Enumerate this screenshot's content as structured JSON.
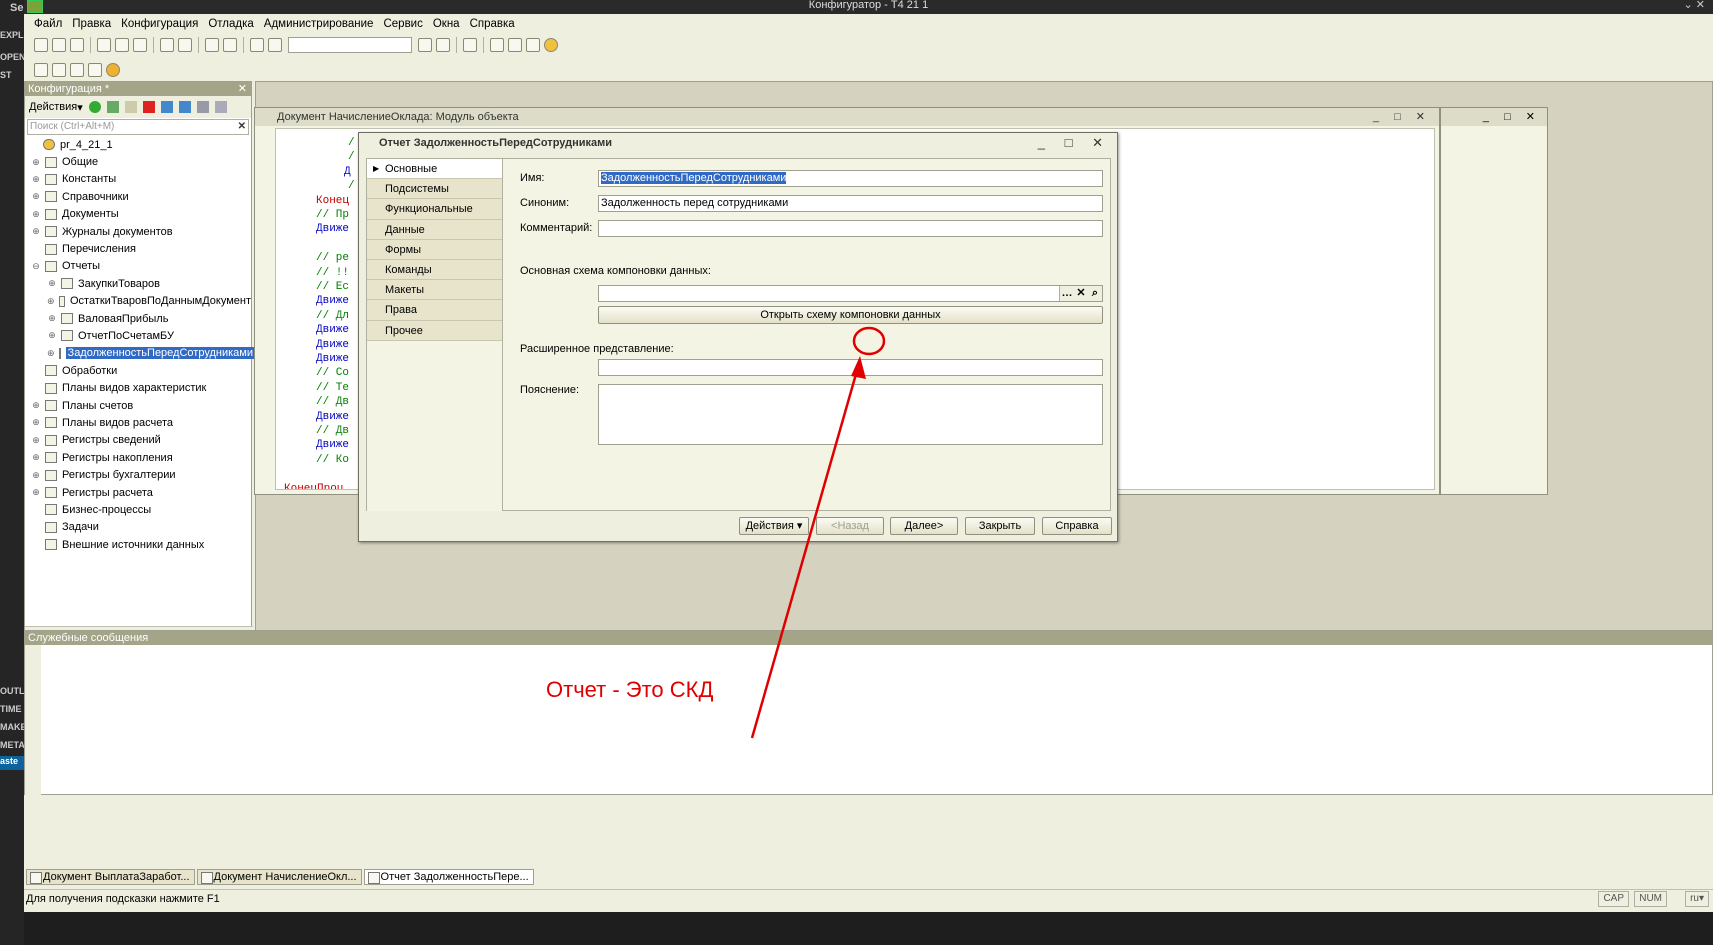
{
  "window_title": "Конфигуратор - Т4 21 1",
  "outline_strip": {
    "items": [
      "Se",
      "EXPL",
      "OPEN",
      "ST",
      "OUTL",
      "TIME",
      "MAKE",
      "META",
      "aste"
    ]
  },
  "menu": [
    "Файл",
    "Правка",
    "Конфигурация",
    "Отладка",
    "Администрирование",
    "Сервис",
    "Окна",
    "Справка"
  ],
  "config_panel": {
    "title": "Конфигурация *",
    "actions_label": "Действия",
    "search_placeholder": "Поиск (Ctrl+Alt+M)",
    "tree": [
      {
        "label": "pr_4_21_1",
        "level": 0,
        "expander": ""
      },
      {
        "label": "Общие",
        "level": 1,
        "expander": "⊕"
      },
      {
        "label": "Константы",
        "level": 1,
        "expander": "⊕"
      },
      {
        "label": "Справочники",
        "level": 1,
        "expander": "⊕"
      },
      {
        "label": "Документы",
        "level": 1,
        "expander": "⊕"
      },
      {
        "label": "Журналы документов",
        "level": 1,
        "expander": "⊕"
      },
      {
        "label": "Перечисления",
        "level": 1,
        "expander": ""
      },
      {
        "label": "Отчеты",
        "level": 1,
        "expander": "⊖"
      },
      {
        "label": "ЗакупкиТоваров",
        "level": 2,
        "expander": "⊕"
      },
      {
        "label": "ОстаткиТваровПоДаннымДокумент",
        "level": 2,
        "expander": "⊕"
      },
      {
        "label": "ВаловаяПрибыль",
        "level": 2,
        "expander": "⊕"
      },
      {
        "label": "ОтчетПоСчетамБУ",
        "level": 2,
        "expander": "⊕"
      },
      {
        "label": "ЗадолженностьПередСотрудниками",
        "level": 2,
        "expander": "⊕",
        "selected": true
      },
      {
        "label": "Обработки",
        "level": 1,
        "expander": ""
      },
      {
        "label": "Планы видов характеристик",
        "level": 1,
        "expander": ""
      },
      {
        "label": "Планы счетов",
        "level": 1,
        "expander": "⊕"
      },
      {
        "label": "Планы видов расчета",
        "level": 1,
        "expander": "⊕"
      },
      {
        "label": "Регистры сведений",
        "level": 1,
        "expander": "⊕"
      },
      {
        "label": "Регистры накопления",
        "level": 1,
        "expander": "⊕"
      },
      {
        "label": "Регистры бухгалтерии",
        "level": 1,
        "expander": "⊕"
      },
      {
        "label": "Регистры расчета",
        "level": 1,
        "expander": "⊕"
      },
      {
        "label": "Бизнес-процессы",
        "level": 1,
        "expander": ""
      },
      {
        "label": "Задачи",
        "level": 1,
        "expander": ""
      },
      {
        "label": "Внешние источники данных",
        "level": 1,
        "expander": ""
      }
    ]
  },
  "module_window": {
    "title": "Документ НачислениеОклада: Модуль объекта",
    "code_lines": [
      {
        "text": "/",
        "cls": "c-grn",
        "indent": 72
      },
      {
        "text": "/",
        "cls": "c-grn",
        "indent": 72
      },
      {
        "text": "Д",
        "cls": "c-blu",
        "indent": 68
      },
      {
        "text": "/",
        "cls": "c-grn",
        "indent": 72
      },
      {
        "text": "Конец",
        "cls": "c-red",
        "indent": 40
      },
      {
        "text": "// Пр",
        "cls": "c-grn",
        "indent": 40
      },
      {
        "text": "Движе",
        "cls": "c-blu",
        "indent": 40
      },
      {
        "text": "",
        "cls": "",
        "indent": 40
      },
      {
        "text": "// ре",
        "cls": "c-grn",
        "indent": 40
      },
      {
        "text": "// !!",
        "cls": "c-grn",
        "indent": 40
      },
      {
        "text": "// Ес",
        "cls": "c-grn",
        "indent": 40
      },
      {
        "text": "Движе",
        "cls": "c-blu",
        "indent": 40
      },
      {
        "text": "// Дл",
        "cls": "c-grn",
        "indent": 40
      },
      {
        "text": "Движе",
        "cls": "c-blu",
        "indent": 40
      },
      {
        "text": "Движе",
        "cls": "c-blu",
        "indent": 40
      },
      {
        "text": "Движе",
        "cls": "c-blu",
        "indent": 40
      },
      {
        "text": "// Со",
        "cls": "c-grn",
        "indent": 40
      },
      {
        "text": "// Те",
        "cls": "c-grn",
        "indent": 40
      },
      {
        "text": "// Дв",
        "cls": "c-grn",
        "indent": 40
      },
      {
        "text": "Движе",
        "cls": "c-blu",
        "indent": 40
      },
      {
        "text": "// Дв",
        "cls": "c-grn",
        "indent": 40
      },
      {
        "text": "Движе",
        "cls": "c-blu",
        "indent": 40
      },
      {
        "text": "// Ко",
        "cls": "c-grn",
        "indent": 40
      },
      {
        "text": "",
        "cls": "",
        "indent": 40
      },
      {
        "text": "КонецПроц",
        "cls": "c-red",
        "indent": 8
      }
    ]
  },
  "dialog": {
    "title": "Отчет ЗадолженностьПередСотрудниками",
    "tabs": [
      "Основные",
      "Подсистемы",
      "Функциональные опции",
      "Данные",
      "Формы",
      "Команды",
      "Макеты",
      "Права",
      "Прочее"
    ],
    "fields": {
      "name_label": "Имя:",
      "name_value": "ЗадолженностьПередСотрудниками",
      "synonym_label": "Синоним:",
      "synonym_value": "Задолженность перед сотрудниками",
      "comment_label": "Комментарий:",
      "comment_value": "",
      "schema_label": "Основная схема компоновки данных:",
      "schema_value": "",
      "open_schema_button": "Открыть схему компоновки данных",
      "ext_repr_label": "Расширенное представление:",
      "ext_repr_value": "",
      "explanation_label": "Пояснение:",
      "explanation_value": ""
    },
    "buttons": {
      "actions": "Действия",
      "back": "<Назад",
      "next": "Далее>",
      "close": "Закрыть",
      "help": "Справка"
    }
  },
  "messages_panel": {
    "title": "Служебные сообщения"
  },
  "annotation": {
    "text": "Отчет - Это СКД",
    "color": "#e00000"
  },
  "window_tabs": [
    {
      "label": "Документ ВыплатаЗаработ...",
      "active": false
    },
    {
      "label": "Документ НачислениеОкл...",
      "active": false
    },
    {
      "label": "Отчет ЗадолженностьПере...",
      "active": true
    }
  ],
  "status_bar": {
    "hint": "Для получения подсказки нажмите F1",
    "cap": "CAP",
    "num": "NUM",
    "lang": "ru"
  }
}
